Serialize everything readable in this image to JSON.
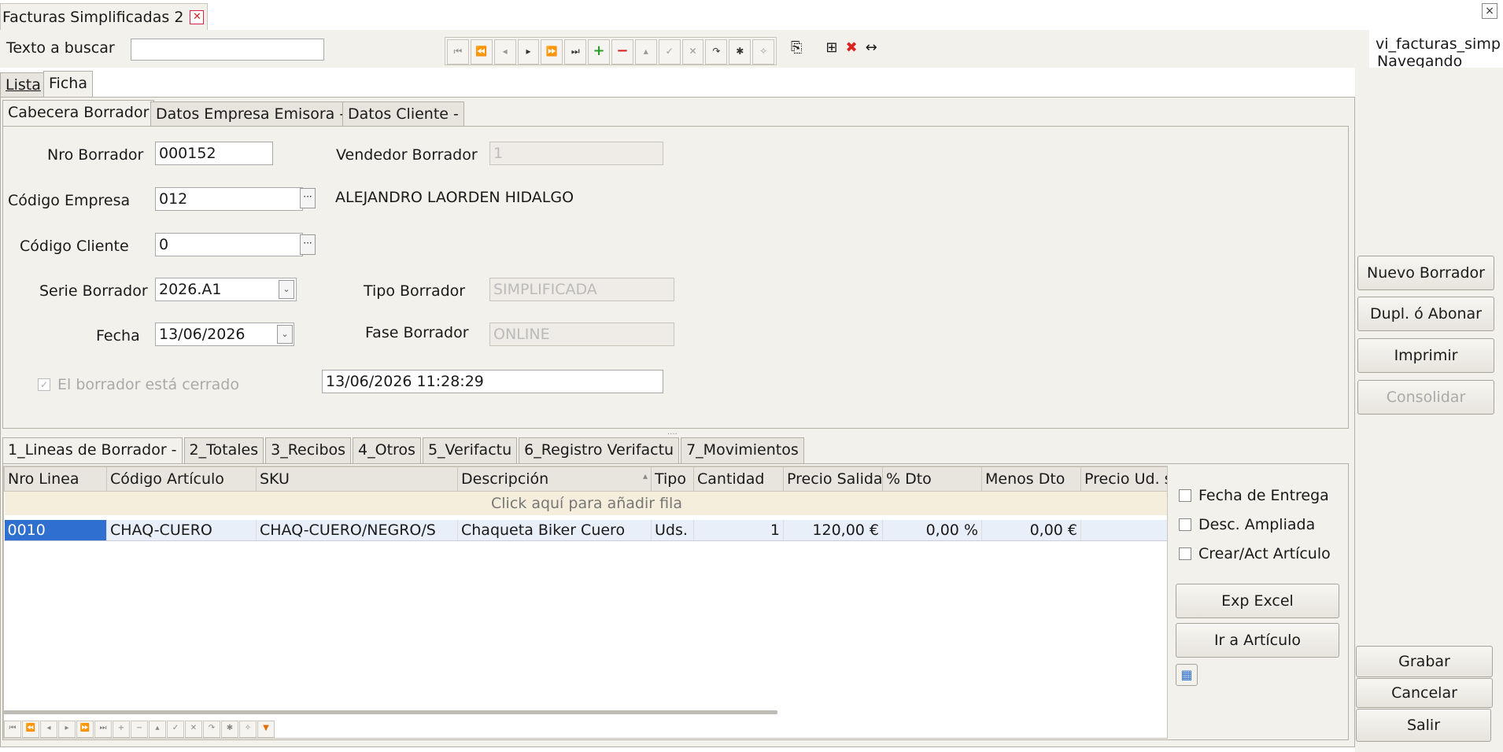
{
  "window": {
    "doc_tab_title": "Facturas Simplificadas 2",
    "close_glyph": "×",
    "tab_close_glyph": "✕"
  },
  "search": {
    "label": "Texto a buscar",
    "value": ""
  },
  "toolbar": {
    "nav_icons": [
      "first-icon",
      "prev-page-icon",
      "prev-icon",
      "next-icon",
      "next-page-icon",
      "last-icon",
      "add-icon",
      "delete-icon",
      "up-icon",
      "accept-icon",
      "cancel-icon",
      "refresh-icon",
      "star-icon",
      "star-outline-icon"
    ],
    "nav_glyphs": [
      "⏮",
      "⏪",
      "◂",
      "▸",
      "⏩",
      "⏭",
      "+",
      "−",
      "▴",
      "✓",
      "✕",
      "↷",
      "✱",
      "✧"
    ],
    "extra_glyphs": [
      "⎘",
      "⊞",
      "✖",
      "↔"
    ]
  },
  "status": {
    "view_name": "vi_facturas_simp",
    "mode": "Navegando"
  },
  "main_tabs": {
    "list": "Lista",
    "form": "Ficha"
  },
  "form_tabs": [
    "Cabecera Borrador",
    "Datos Empresa Emisora -",
    "Datos Cliente -"
  ],
  "form": {
    "nro_borrador": {
      "label": "Nro Borrador",
      "value": "000152"
    },
    "vendedor_borrador": {
      "label": "Vendedor Borrador",
      "value": "1"
    },
    "codigo_empresa": {
      "label": "Código Empresa",
      "value": "012",
      "name": "ALEJANDRO LAORDEN HIDALGO"
    },
    "codigo_cliente": {
      "label": "Código Cliente",
      "value": "0"
    },
    "serie_borrador": {
      "label": "Serie Borrador",
      "value": "2026.A1"
    },
    "tipo_borrador": {
      "label": "Tipo Borrador",
      "value": "SIMPLIFICADA"
    },
    "fecha": {
      "label": "Fecha",
      "value": "13/06/2026"
    },
    "fase_borrador": {
      "label": "Fase Borrador",
      "value": "ONLINE"
    },
    "cerrado": {
      "label": "El borrador está cerrado",
      "timestamp": "13/06/2026 11:28:29"
    },
    "ellipsis_glyph": "···",
    "dropdown_glyph": "⌄"
  },
  "side_buttons": {
    "nuevo": "Nuevo Borrador",
    "duplicar": "Dupl. ó Abonar",
    "imprimir": "Imprimir",
    "consolidar": "Consolidar",
    "grabar": "Grabar",
    "cancelar": "Cancelar",
    "salir": "Salir"
  },
  "detail_tabs": [
    "1_Lineas de Borrador -",
    "2_Totales",
    "3_Recibos",
    "4_Otros",
    "5_Verifactu",
    "6_Registro Verifactu",
    "7_Movimientos"
  ],
  "grid": {
    "columns": [
      "Nro Linea",
      "Código Artículo",
      "SKU",
      "Descripción",
      "Tipo",
      "Cantidad",
      "Precio Salida",
      "% Dto",
      "Menos Dto",
      "Precio Ud. s"
    ],
    "add_row_text": "Click aquí para añadir fila",
    "sort_glyph": "▴",
    "rows": [
      [
        "0010",
        "CHAQ-CUERO",
        "CHAQ-CUERO/NEGRO/S",
        "Chaqueta Biker Cuero",
        "Uds.",
        "1",
        "120,00 €",
        "0,00 %",
        "0,00 €",
        ""
      ]
    ],
    "bottom_nav_glyphs": [
      "⏮",
      "⏪",
      "◂",
      "▸",
      "⏩",
      "⏭",
      "+",
      "−",
      "▴",
      "✓",
      "✕",
      "↷",
      "✱",
      "✧",
      "▼"
    ]
  },
  "grid_options": {
    "fecha_entrega": "Fecha de Entrega",
    "desc_ampliada": "Desc. Ampliada",
    "crear_articulo": "Crear/Act Artículo",
    "exp_excel": "Exp Excel",
    "ir_articulo": "Ir a Artículo"
  },
  "colors": {
    "accent_green": "#2a9d2a",
    "accent_red": "#d22222",
    "selection_blue": "#2f6fd0"
  }
}
